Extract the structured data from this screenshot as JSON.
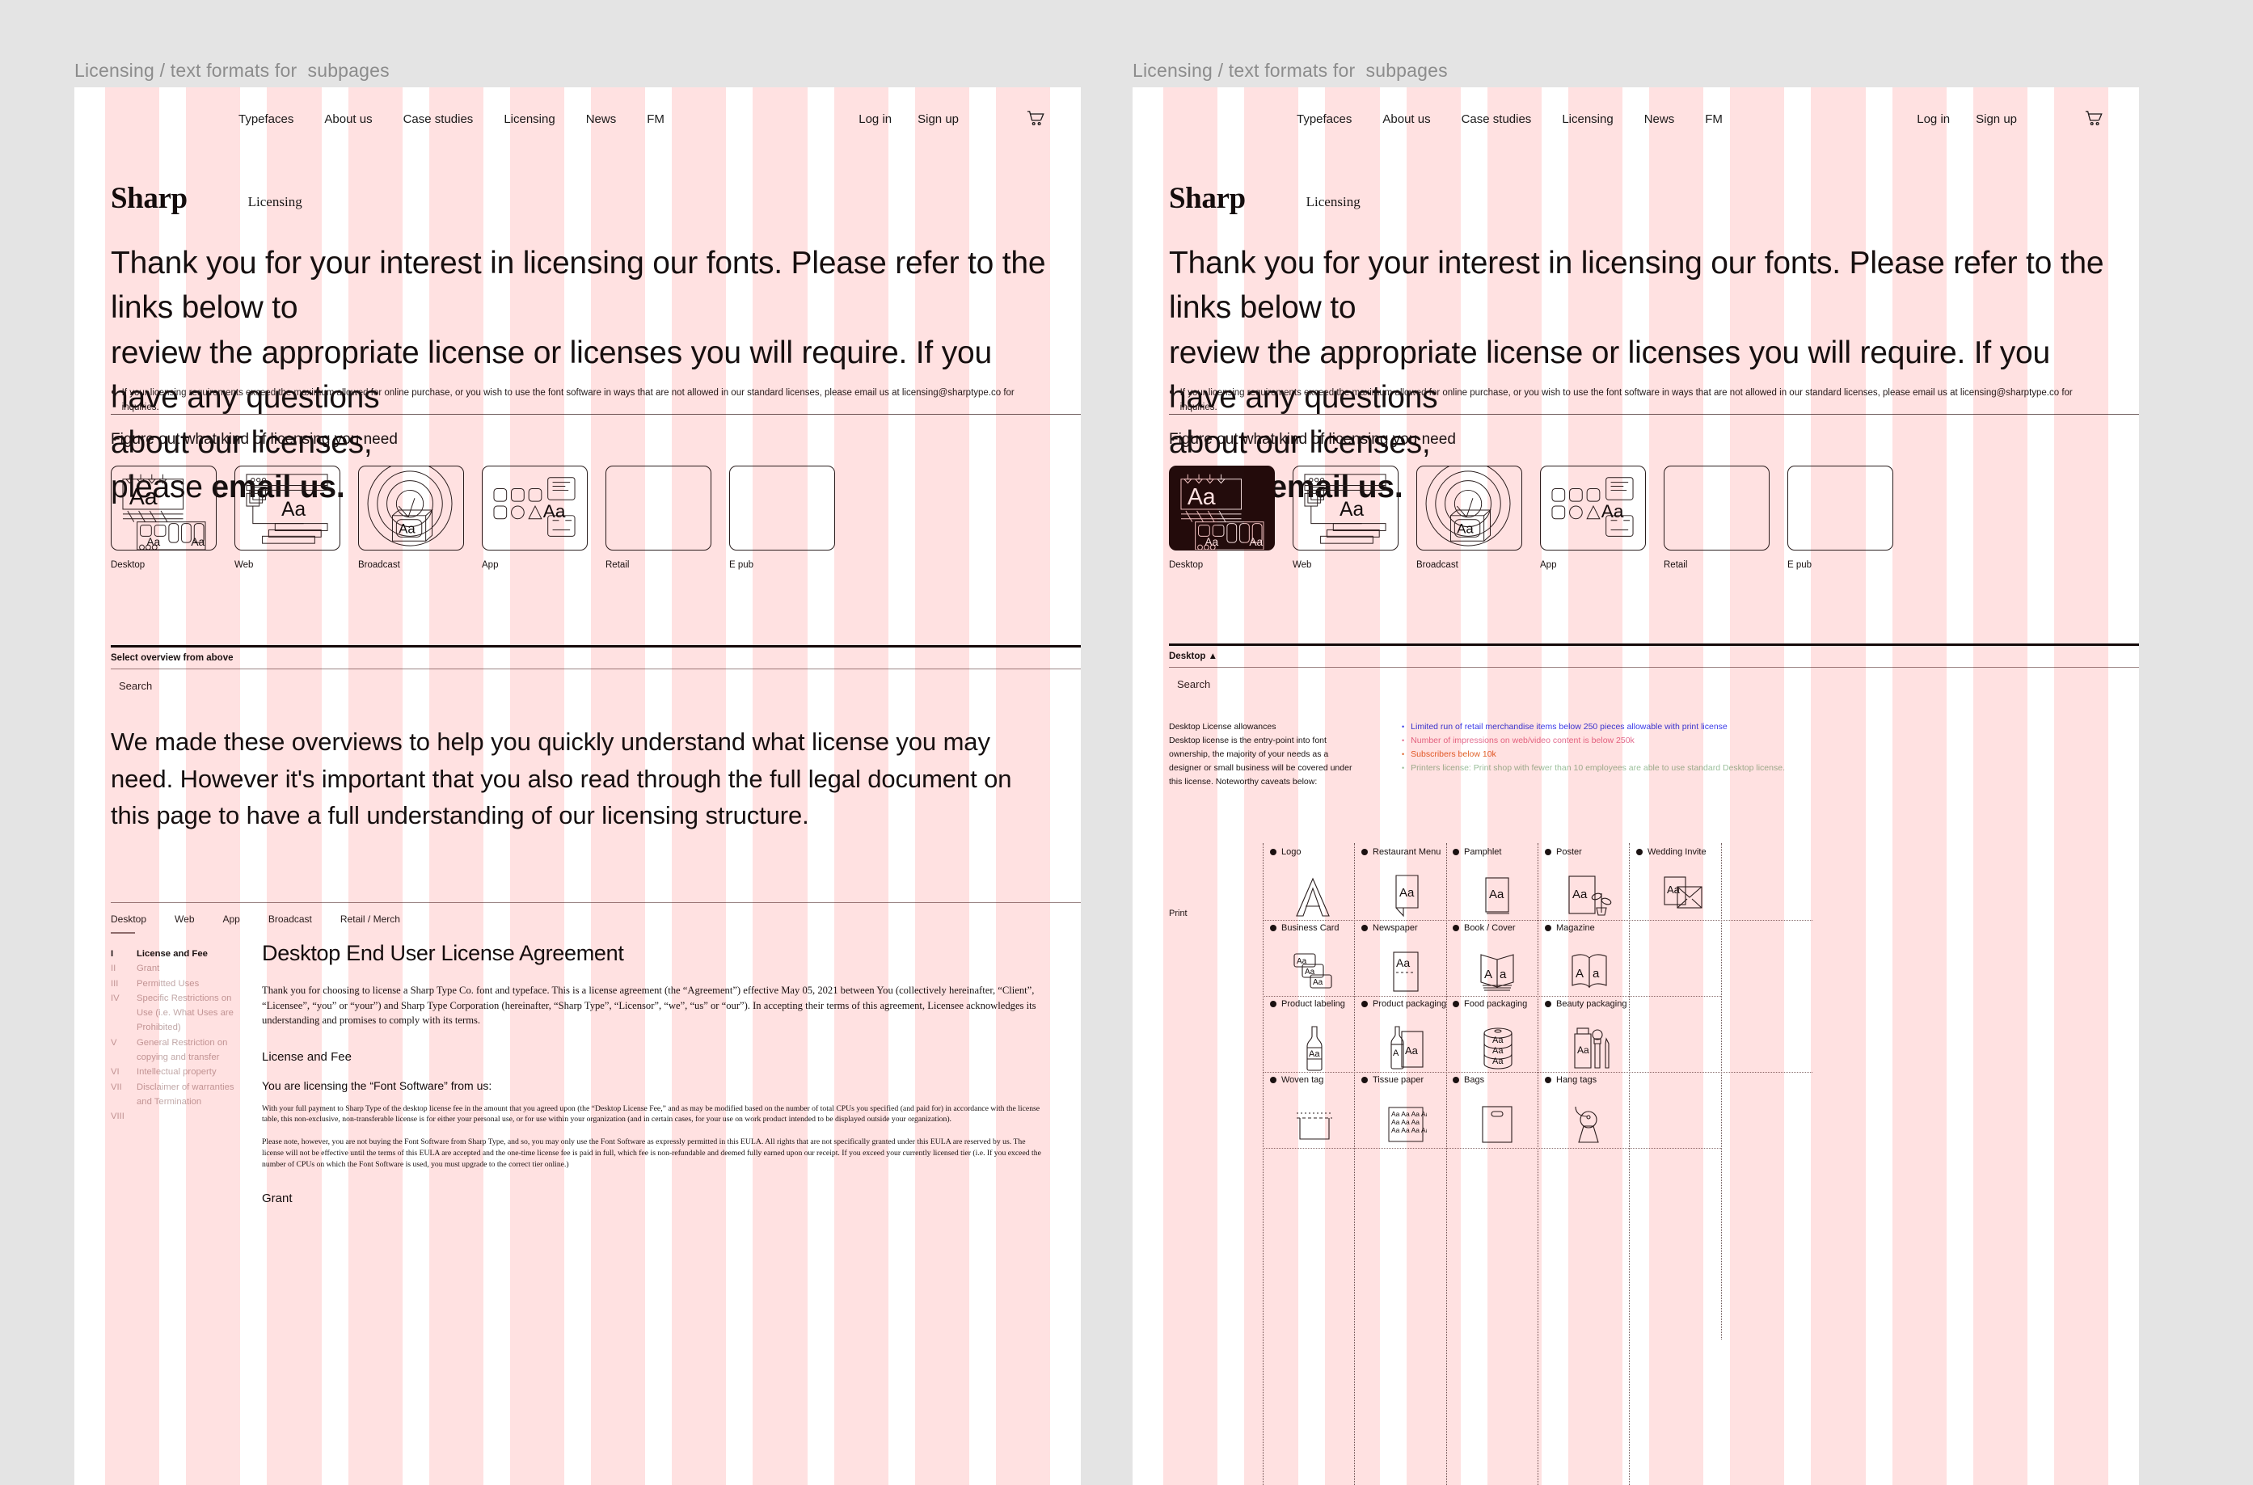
{
  "boards": {
    "left_label": "Licensing / text formats for  subpages",
    "right_label": "Licensing / text formats for  subpages"
  },
  "nav": {
    "main": [
      "Typefaces",
      "About us",
      "Case studies",
      "Licensing",
      "News",
      "FM"
    ],
    "login": "Log in",
    "signup": "Sign up",
    "cart_icon": "shopping-cart-icon"
  },
  "brand": {
    "name": "Sharp",
    "sub": "Licensing"
  },
  "hero": {
    "line1": "Thank you for your interest in licensing our fonts. Please refer to the links below to",
    "line2": "review the appropriate license or licenses you will require. If you have any questions",
    "line3": "about our licenses,",
    "line4_prefix": "please ",
    "line4_bold": "email us."
  },
  "note": {
    "bullet": "●",
    "text": "If your licensing requirements exceed the maximum allowed for online purchase, or you wish to use the font software in ways that are not allowed in our standard licenses, please email us at licensing@sharptype.co for inquiries."
  },
  "section_title": "Figure out what kind of licensing you need",
  "license_cards": [
    {
      "label": "Desktop",
      "icon": "desktop-license-icon"
    },
    {
      "label": "Web",
      "icon": "web-license-icon"
    },
    {
      "label": "Broadcast",
      "icon": "broadcast-license-icon"
    },
    {
      "label": "App",
      "icon": "app-license-icon"
    },
    {
      "label": "Retail",
      "icon": "retail-license-icon"
    },
    {
      "label": "E pub",
      "icon": "epub-license-icon"
    }
  ],
  "left_panel": {
    "select_bar": "Select overview from above",
    "search_placeholder": "Search",
    "big_paragraph": "We made these overviews to help you quickly understand what license you may need. However it's important that you also read through the full legal document on this page to have a full understanding of our licensing structure."
  },
  "right_panel": {
    "select_bar": "Desktop ▲",
    "search_placeholder": "Search",
    "allowances_title": "Desktop License allowances",
    "allowances_body": "Desktop license is the entry-point into font ownership, the majority of your needs as a designer or small business will be covered under this license. Noteworthy caveats below:",
    "caveats": [
      {
        "text": "Limited run of retail merchandise items below 250 pieces allowable with print license",
        "color": "#3a3ae8"
      },
      {
        "text": "Number of impressions on web/video content is below 250k",
        "color": "#e36d8f"
      },
      {
        "text": "Subscribers below 10k",
        "color": "#e0632a"
      },
      {
        "text": "Printers license: Print shop with fewer than 10 employees are able to use standard Desktop license.",
        "color": "#9bbf9b"
      }
    ],
    "group_label": "Print",
    "use_cases": [
      {
        "label": "Logo",
        "icon": "logo-letter-icon"
      },
      {
        "label": "Restaurant Menu",
        "icon": "restaurant-menu-icon"
      },
      {
        "label": "Pamphlet",
        "icon": "pamphlet-icon"
      },
      {
        "label": "Poster",
        "icon": "poster-plant-icon"
      },
      {
        "label": "Wedding Invite",
        "icon": "wedding-invite-icon"
      },
      {
        "label": "Business Card",
        "icon": "business-card-icon"
      },
      {
        "label": "Newspaper",
        "icon": "newspaper-icon"
      },
      {
        "label": "Book / Cover",
        "icon": "book-cover-icon"
      },
      {
        "label": "Magazine",
        "icon": "magazine-icon"
      },
      {
        "label": "",
        "icon": ""
      },
      {
        "label": "Product labeling",
        "icon": "bottle-label-icon"
      },
      {
        "label": "Product packaging",
        "icon": "product-package-icon"
      },
      {
        "label": "Food packaging",
        "icon": "food-can-icon"
      },
      {
        "label": "Beauty packaging",
        "icon": "beauty-package-icon"
      },
      {
        "label": "",
        "icon": ""
      },
      {
        "label": "Woven tag",
        "icon": "woven-tag-icon"
      },
      {
        "label": "Tissue paper",
        "icon": "tissue-paper-icon"
      },
      {
        "label": "Bags",
        "icon": "shopping-bag-icon"
      },
      {
        "label": "Hang tags",
        "icon": "hang-tag-icon"
      },
      {
        "label": "",
        "icon": ""
      }
    ]
  },
  "eula": {
    "tabs": [
      {
        "label": "Desktop",
        "active": true
      },
      {
        "label": "Web",
        "active": false
      },
      {
        "label": "App",
        "active": false
      },
      {
        "label": "Broadcast",
        "active": false
      },
      {
        "label": "Retail / Merch",
        "active": false
      }
    ],
    "toc": [
      {
        "num": "I",
        "label": "License and Fee",
        "active": true
      },
      {
        "num": "II",
        "label": "Grant",
        "active": false
      },
      {
        "num": "III",
        "label": "Permitted Uses",
        "active": false
      },
      {
        "num": "IV",
        "label": "Specific Restrictions on Use (i.e. What Uses are Prohibited)",
        "active": false
      },
      {
        "num": "V",
        "label": "General Restriction on copying and transfer",
        "active": false
      },
      {
        "num": "VI",
        "label": "Intellectual property",
        "active": false
      },
      {
        "num": "VII",
        "label": "Disclaimer of warranties and Termination",
        "active": false
      },
      {
        "num": "VIII",
        "label": "",
        "active": false
      }
    ],
    "title": "Desktop End User License Agreement",
    "intro": "Thank you for choosing to license a Sharp Type Co. font and typeface. This is a license agreement (the “Agreement”) effective May 05, 2021 between You (collectively hereinafter, “Client”, “Licensee”, “you” or “your”) and Sharp Type Corporation (hereinafter, “Sharp Type”, “Licensor”, “we”, “us” or “our”). In accepting their terms of this agreement, Licensee acknowledges its understanding and promises to comply with its terms.",
    "h2": "License and Fee",
    "h3": "You are licensing the “Font Software” from us:",
    "para1": "With your full payment to Sharp Type of the desktop license fee in the amount that you agreed upon (the “Desktop License Fee,” and as may be modified based on the number of total CPUs you specified (and paid for) in accordance with the license table, this non-exclusive, non-transferable license is for either your personal use, or for use within your organization (and in certain cases, for your use on work product intended to be displayed outside your organization).",
    "para2": "Please note, however, you are not buying the Font Software from Sharp Type, and so, you may only use the Font Software as expressly permitted in this EULA. All rights that are not specifically granted under this EULA are reserved by us. The license will not be effective until the terms of this EULA are accepted and the one-time license fee is paid in full, which fee is non-refundable and deemed fully earned upon our receipt. If you exceed your currently licensed tier (i.e. If you exceed the number of CPUs on which the Font Software is used, you must upgrade to the correct tier online.)",
    "h3b": "Grant"
  }
}
